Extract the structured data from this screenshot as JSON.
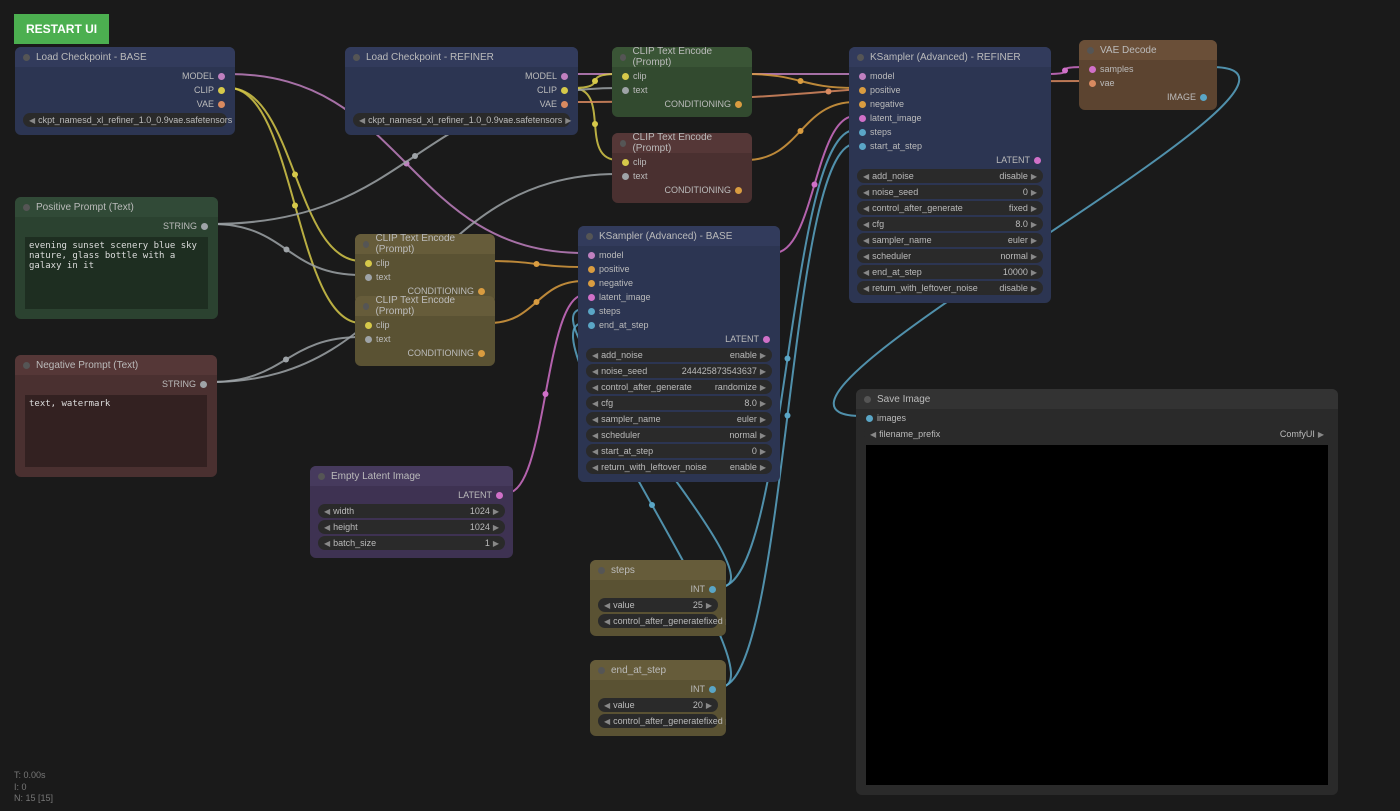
{
  "ui": {
    "restart_label": "RESTART UI",
    "status": {
      "t": "T: 0.00s",
      "i": "I: 0",
      "n": "N: 15 [15]"
    }
  },
  "colors": {
    "model": "#c080c0",
    "clip": "#d6c94a",
    "vae": "#d98a60",
    "cond": "#d99c40",
    "string": "#9ea3a7",
    "latent": "#d070c8",
    "int": "#5aa6c6",
    "image": "#5aa6c6"
  },
  "nodes": {
    "ckpt_base": {
      "title": "Load Checkpoint - BASE",
      "outputs": [
        "MODEL",
        "CLIP",
        "VAE"
      ],
      "ckpt_label": "ckpt_name",
      "ckpt_value": "sd_xl_refiner_1.0_0.9vae.safetensors"
    },
    "ckpt_ref": {
      "title": "Load Checkpoint - REFINER",
      "outputs": [
        "MODEL",
        "CLIP",
        "VAE"
      ],
      "ckpt_label": "ckpt_name",
      "ckpt_value": "sd_xl_refiner_1.0_0.9vae.safetensors"
    },
    "pos_prompt": {
      "title": "Positive Prompt (Text)",
      "output": "STRING",
      "text": "evening sunset scenery blue sky nature, glass bottle with a galaxy in it"
    },
    "neg_prompt": {
      "title": "Negative Prompt (Text)",
      "output": "STRING",
      "text": "text, watermark"
    },
    "clip_ref_pos": {
      "title": "CLIP Text Encode (Prompt)",
      "in1": "clip",
      "in2": "text",
      "out": "CONDITIONING"
    },
    "clip_ref_neg": {
      "title": "CLIP Text Encode (Prompt)",
      "in1": "clip",
      "in2": "text",
      "out": "CONDITIONING"
    },
    "clip_base_pos": {
      "title": "CLIP Text Encode (Prompt)",
      "in1": "clip",
      "in2": "text",
      "out": "CONDITIONING"
    },
    "clip_base_neg": {
      "title": "CLIP Text Encode (Prompt)",
      "in1": "clip",
      "in2": "text",
      "out": "CONDITIONING"
    },
    "empty_latent": {
      "title": "Empty Latent Image",
      "out": "LATENT",
      "w_label": "width",
      "w_val": "1024",
      "h_label": "height",
      "h_val": "1024",
      "b_label": "batch_size",
      "b_val": "1"
    },
    "ksamp_base": {
      "title": "KSampler (Advanced) - BASE",
      "out": "LATENT",
      "inputs": [
        "model",
        "positive",
        "negative",
        "latent_image",
        "steps",
        "end_at_step"
      ],
      "widgets": [
        {
          "k": "add_noise",
          "v": "enable"
        },
        {
          "k": "noise_seed",
          "v": "244425873543637"
        },
        {
          "k": "control_after_generate",
          "v": "randomize"
        },
        {
          "k": "cfg",
          "v": "8.0"
        },
        {
          "k": "sampler_name",
          "v": "euler"
        },
        {
          "k": "scheduler",
          "v": "normal"
        },
        {
          "k": "start_at_step",
          "v": "0"
        },
        {
          "k": "return_with_leftover_noise",
          "v": "enable"
        }
      ]
    },
    "ksamp_ref": {
      "title": "KSampler (Advanced) - REFINER",
      "out": "LATENT",
      "inputs": [
        "model",
        "positive",
        "negative",
        "latent_image",
        "steps",
        "start_at_step"
      ],
      "widgets": [
        {
          "k": "add_noise",
          "v": "disable"
        },
        {
          "k": "noise_seed",
          "v": "0"
        },
        {
          "k": "control_after_generate",
          "v": "fixed"
        },
        {
          "k": "cfg",
          "v": "8.0"
        },
        {
          "k": "sampler_name",
          "v": "euler"
        },
        {
          "k": "scheduler",
          "v": "normal"
        },
        {
          "k": "end_at_step",
          "v": "10000"
        },
        {
          "k": "return_with_leftover_noise",
          "v": "disable"
        }
      ]
    },
    "vae_decode": {
      "title": "VAE Decode",
      "in1": "samples",
      "in2": "vae",
      "out": "IMAGE"
    },
    "save_img": {
      "title": "Save Image",
      "in1": "images",
      "w_label": "filename_prefix",
      "w_val": "ComfyUI"
    },
    "steps": {
      "title": "steps",
      "out": "INT",
      "v_label": "value",
      "v_val": "25",
      "c_label": "control_after_generate",
      "c_val": "fixed"
    },
    "end_at": {
      "title": "end_at_step",
      "out": "INT",
      "v_label": "value",
      "v_val": "20",
      "c_label": "control_after_generate",
      "c_val": "fixed"
    }
  },
  "links": [
    {
      "from": "ckpt_base.MODEL",
      "to": "ksamp_base.model",
      "c": "model"
    },
    {
      "from": "ckpt_base.CLIP",
      "to": "clip_base_pos.clip",
      "c": "clip"
    },
    {
      "from": "ckpt_base.CLIP",
      "to": "clip_base_neg.clip",
      "c": "clip"
    },
    {
      "from": "ckpt_ref.MODEL",
      "to": "ksamp_ref.model",
      "c": "model"
    },
    {
      "from": "ckpt_ref.CLIP",
      "to": "clip_ref_pos.clip",
      "c": "clip"
    },
    {
      "from": "ckpt_ref.CLIP",
      "to": "clip_ref_neg.clip",
      "c": "clip"
    },
    {
      "from": "ckpt_ref.VAE",
      "to": "vae_decode.vae",
      "c": "vae"
    },
    {
      "from": "pos_prompt.STRING",
      "to": "clip_base_pos.text",
      "c": "string"
    },
    {
      "from": "pos_prompt.STRING",
      "to": "clip_ref_pos.text",
      "c": "string"
    },
    {
      "from": "neg_prompt.STRING",
      "to": "clip_base_neg.text",
      "c": "string"
    },
    {
      "from": "neg_prompt.STRING",
      "to": "clip_ref_neg.text",
      "c": "string"
    },
    {
      "from": "clip_base_pos.CONDITIONING",
      "to": "ksamp_base.positive",
      "c": "cond"
    },
    {
      "from": "clip_base_neg.CONDITIONING",
      "to": "ksamp_base.negative",
      "c": "cond"
    },
    {
      "from": "clip_ref_pos.CONDITIONING",
      "to": "ksamp_ref.positive",
      "c": "cond"
    },
    {
      "from": "clip_ref_neg.CONDITIONING",
      "to": "ksamp_ref.negative",
      "c": "cond"
    },
    {
      "from": "empty_latent.LATENT",
      "to": "ksamp_base.latent_image",
      "c": "latent"
    },
    {
      "from": "ksamp_base.LATENT",
      "to": "ksamp_ref.latent_image",
      "c": "latent"
    },
    {
      "from": "ksamp_ref.LATENT",
      "to": "vae_decode.samples",
      "c": "latent"
    },
    {
      "from": "vae_decode.IMAGE",
      "to": "save_img.images",
      "c": "image"
    },
    {
      "from": "steps.INT",
      "to": "ksamp_base.steps",
      "c": "int"
    },
    {
      "from": "steps.INT",
      "to": "ksamp_ref.steps",
      "c": "int"
    },
    {
      "from": "end_at.INT",
      "to": "ksamp_base.end_at_step",
      "c": "int"
    },
    {
      "from": "end_at.INT",
      "to": "ksamp_ref.start_at_step",
      "c": "int"
    }
  ]
}
